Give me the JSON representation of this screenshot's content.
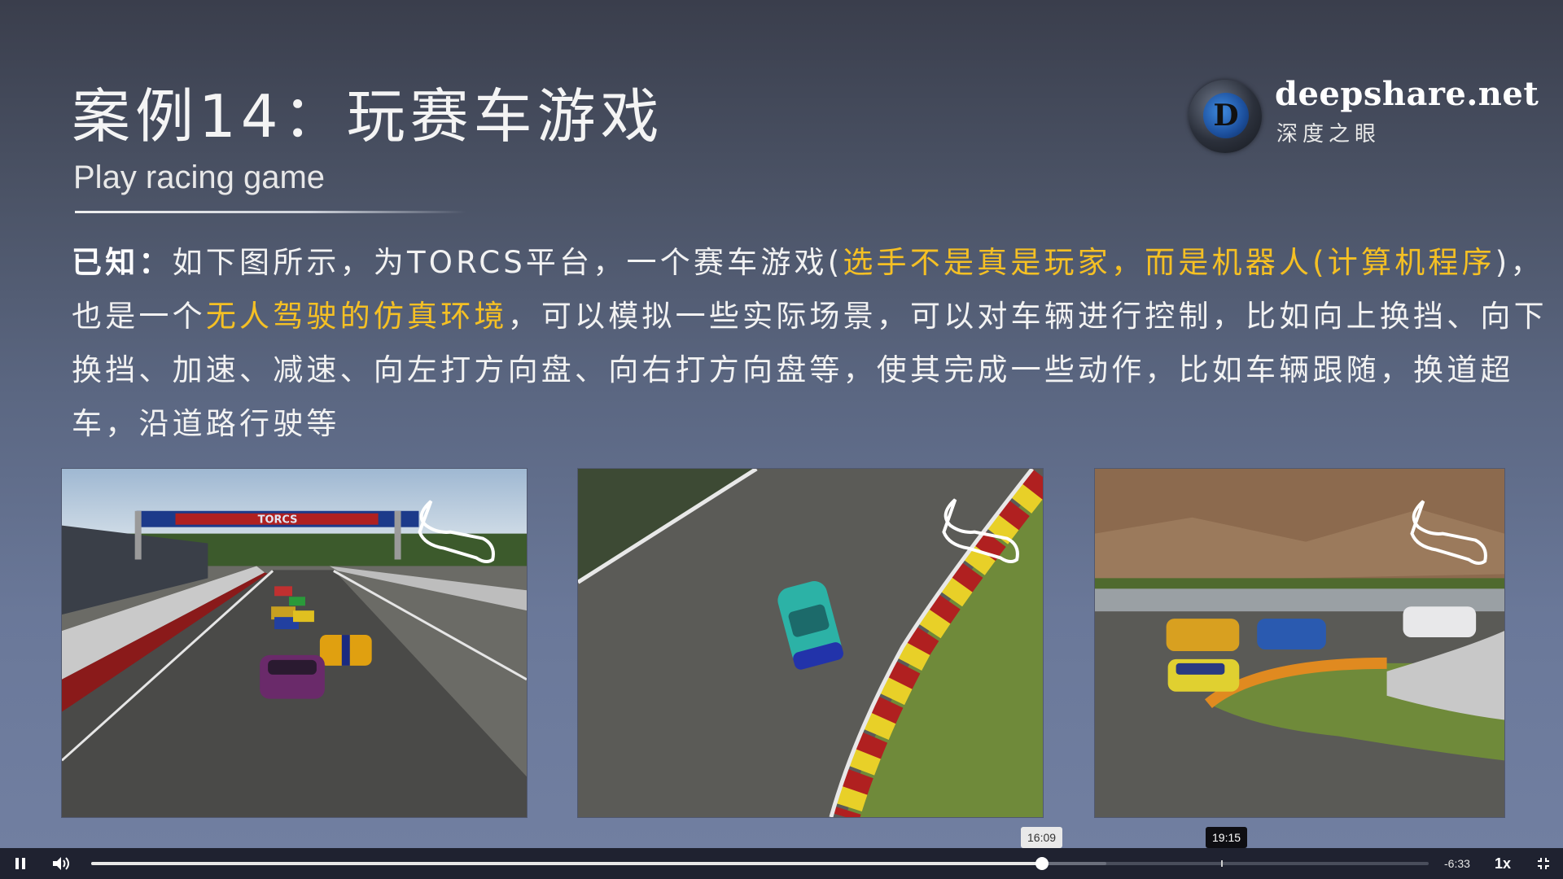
{
  "slide": {
    "title": "案例14：玩赛车游戏",
    "subtitle": "Play racing game",
    "logo": {
      "name": "deepshare.net",
      "sub": "深度之眼",
      "badge_letter": "D"
    },
    "paragraph": {
      "known_label": "已知：",
      "t1": "如下图所示，为TORCS平台，一个赛车游戏(",
      "h1": "选手不是真是玩家，而是机器人(计算机程序",
      "t2": ")，也是一个",
      "h2": "无人驾驶的仿真环境",
      "t3": "，可以模拟一些实际场景，可以对车辆进行控制，比如向上换挡、向下换挡、加速、减速、向左打方向盘、向右打方向盘等，使其完成一些动作，比如车辆跟随，换道超车，沿道路行驶等"
    },
    "screenshots": {
      "banner_text": "TORCS"
    }
  },
  "player": {
    "pause_icon": "pause-icon",
    "volume_icon": "volume-icon",
    "remaining": "-6:33",
    "speed": "1x",
    "fullscreen_icon": "exit-fullscreen-icon",
    "hover_time": "16:09",
    "marker_time": "19:15",
    "played_fraction": 0.711,
    "buffered_fraction": 0.759,
    "colors": {
      "highlight": "#f5c024",
      "bar": "#1f2230"
    }
  }
}
